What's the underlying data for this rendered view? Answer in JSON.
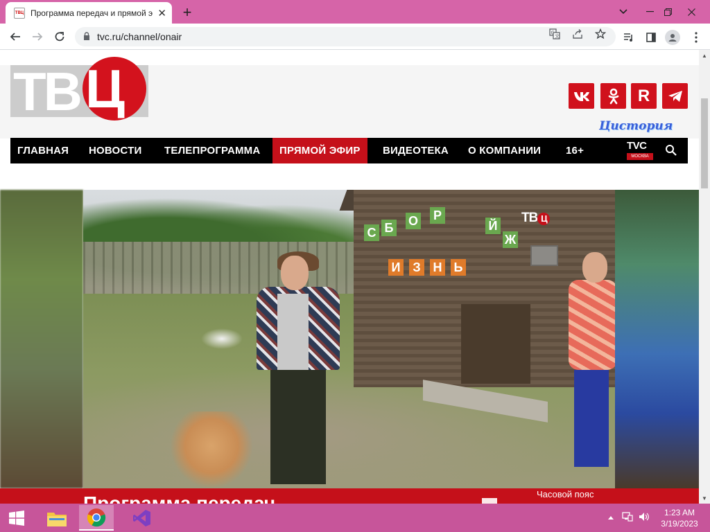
{
  "browser": {
    "tab_title": "Программа передач и прямой э",
    "tab_favicon_text": "ТВЦ",
    "new_tab_label": "+",
    "address": "tvc.ru/channel/onair",
    "controls": {
      "minimize": "⌄",
      "restore": "—",
      "maximize": "❐",
      "close": "✕"
    }
  },
  "site": {
    "logo_text_left": "ТВ",
    "logo_text_circle": "Ц",
    "social": [
      {
        "label": "VK",
        "icon": "vk-icon"
      },
      {
        "label": "ОК",
        "icon": "odnoklassniki-icon"
      },
      {
        "label": "R",
        "icon": "rutube-icon"
      },
      {
        "label": "➤",
        "icon": "telegram-icon"
      }
    ],
    "istoria_label": "Цистория",
    "nav": [
      {
        "label": "ГЛАВНАЯ"
      },
      {
        "label": "НОВОСТИ"
      },
      {
        "label": "ТЕЛЕПРОГРАММА"
      },
      {
        "label": "ПРЯМОЙ ЭФИР",
        "active": true
      },
      {
        "label": "ВИДЕОТЕКА"
      },
      {
        "label": "О КОМПАНИИ"
      },
      {
        "label": "16+"
      }
    ],
    "tvc_badge_top": "TVC",
    "tvc_badge_bottom": "МОСКВА",
    "video_watermark": "ТВ",
    "video_watermark_circle": "Ц",
    "barn_letters": [
      "С",
      "Б",
      "О",
      "Р",
      "Й",
      "Ж",
      "И",
      "З",
      "Н",
      "Ь"
    ],
    "program_heading": "Программа передач",
    "timezone_label": "Часовой пояс"
  },
  "taskbar": {
    "time": "1:23 AM",
    "date": "3/19/2023",
    "apps": [
      {
        "name": "file-explorer",
        "active": false
      },
      {
        "name": "chrome",
        "active": true
      },
      {
        "name": "visual-studio",
        "active": false
      }
    ]
  },
  "colors": {
    "brand_red": "#c5101a",
    "chrome_accent": "#d664a8",
    "taskbar": "#c7559a"
  }
}
